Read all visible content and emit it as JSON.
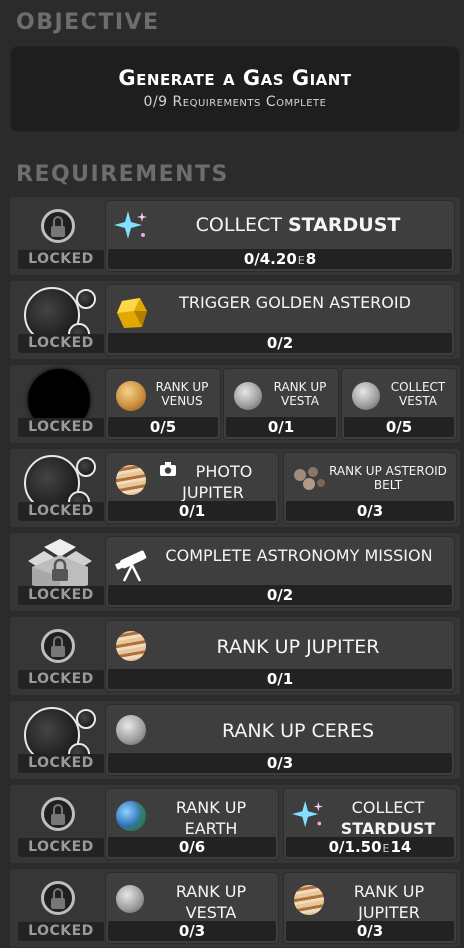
{
  "headings": {
    "objective": "OBJECTIVE",
    "requirements": "REQUIREMENTS"
  },
  "objective": {
    "title": "Generate a Gas Giant",
    "progress": "0/9 Requirements Complete"
  },
  "locked_label": "LOCKED",
  "rows": [
    {
      "tasks": [
        {
          "label_pre": "COLLECT",
          "label_bold": "STARDUST",
          "count": "0/4.20",
          "count_sup": "E",
          "count_exp": "8",
          "icon": "stardust-icon"
        }
      ]
    },
    {
      "tasks": [
        {
          "label": "TRIGGER   GOLDEN ASTEROID",
          "count": "0/2",
          "icon": "golden-asteroid-icon"
        }
      ]
    },
    {
      "tasks": [
        {
          "label": "RANK UP VENUS",
          "count": "0/5",
          "icon": "venus-icon"
        },
        {
          "label": "RANK UP VESTA",
          "count": "0/1",
          "icon": "vesta-icon"
        },
        {
          "label": "COLLECT VESTA",
          "count": "0/5",
          "icon": "vesta-icon"
        }
      ]
    },
    {
      "tasks": [
        {
          "label": "PHOTO JUPITER",
          "count": "0/1",
          "icon": "jupiter-icon"
        },
        {
          "label": "RANK UP ASTEROID BELT",
          "count": "0/3",
          "icon": "asteroid-belt-icon"
        }
      ]
    },
    {
      "tasks": [
        {
          "label": "COMPLETE   ASTRONOMY MISSION",
          "count": "0/2",
          "icon": "telescope-icon"
        }
      ]
    },
    {
      "tasks": [
        {
          "label": "RANK UP JUPITER",
          "count": "0/1",
          "icon": "jupiter-icon"
        }
      ]
    },
    {
      "tasks": [
        {
          "label": "RANK UP CERES",
          "count": "0/3",
          "icon": "ceres-icon"
        }
      ]
    },
    {
      "tasks": [
        {
          "label": "RANK UP EARTH",
          "count": "0/6",
          "icon": "earth-icon"
        },
        {
          "label_pre": "COLLECT",
          "label_bold": "STARDUST",
          "count": "0/1.50",
          "count_sup": "E",
          "count_exp": "14",
          "icon": "stardust-icon"
        }
      ]
    },
    {
      "tasks": [
        {
          "label": "RANK UP VESTA",
          "count": "0/3",
          "icon": "vesta-icon"
        },
        {
          "label": "RANK UP JUPITER",
          "count": "0/3",
          "icon": "jupiter-icon"
        }
      ]
    }
  ],
  "colors": {
    "background": "#2b2b2b",
    "row": "#363636",
    "task": "#3e3e3e",
    "counter": "#222222",
    "heading": "#6d6d6d"
  }
}
